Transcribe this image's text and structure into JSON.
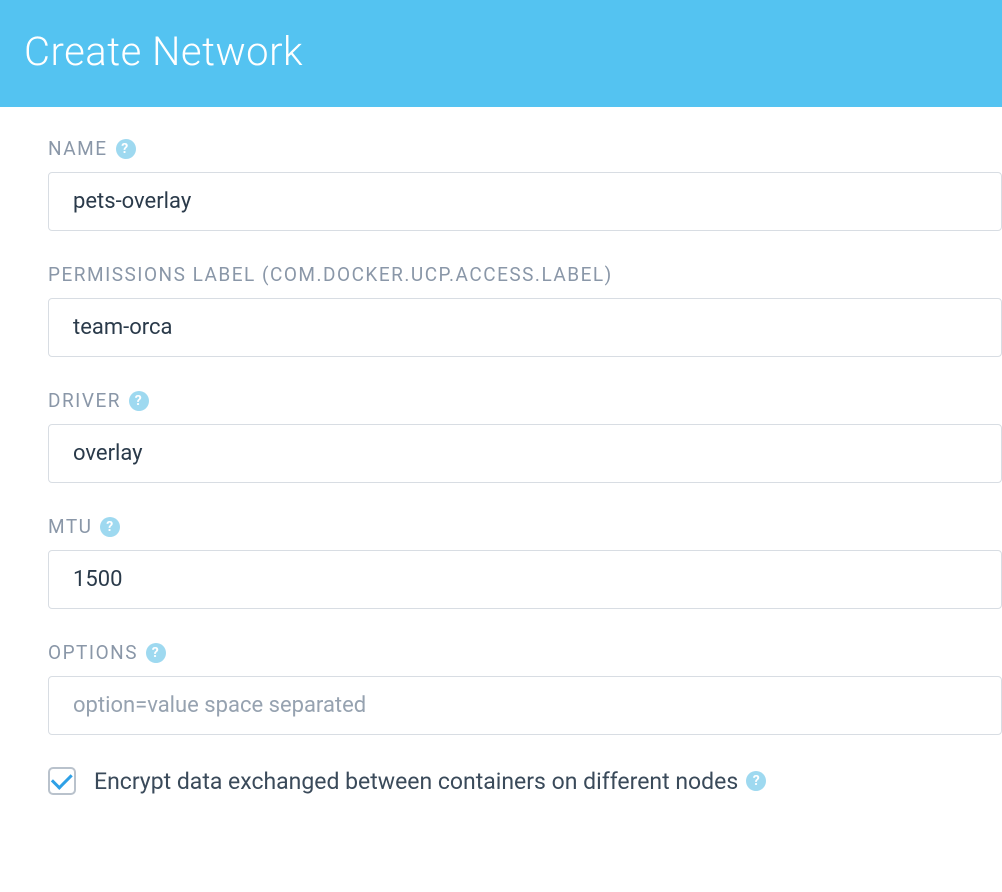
{
  "header": {
    "title": "Create Network"
  },
  "form": {
    "name": {
      "label": "NAME",
      "value": "pets-overlay",
      "has_help": true
    },
    "permissions": {
      "label": "PERMISSIONS LABEL (COM.DOCKER.UCP.ACCESS.LABEL)",
      "value": "team-orca",
      "has_help": false
    },
    "driver": {
      "label": "DRIVER",
      "value": "overlay",
      "has_help": true
    },
    "mtu": {
      "label": "MTU",
      "value": "1500",
      "has_help": true
    },
    "options": {
      "label": "OPTIONS",
      "value": "",
      "placeholder": "option=value space separated",
      "has_help": true
    },
    "encrypt": {
      "label": "Encrypt data exchanged between containers on different nodes",
      "checked": true,
      "has_help": true
    }
  },
  "help_glyph": "?"
}
